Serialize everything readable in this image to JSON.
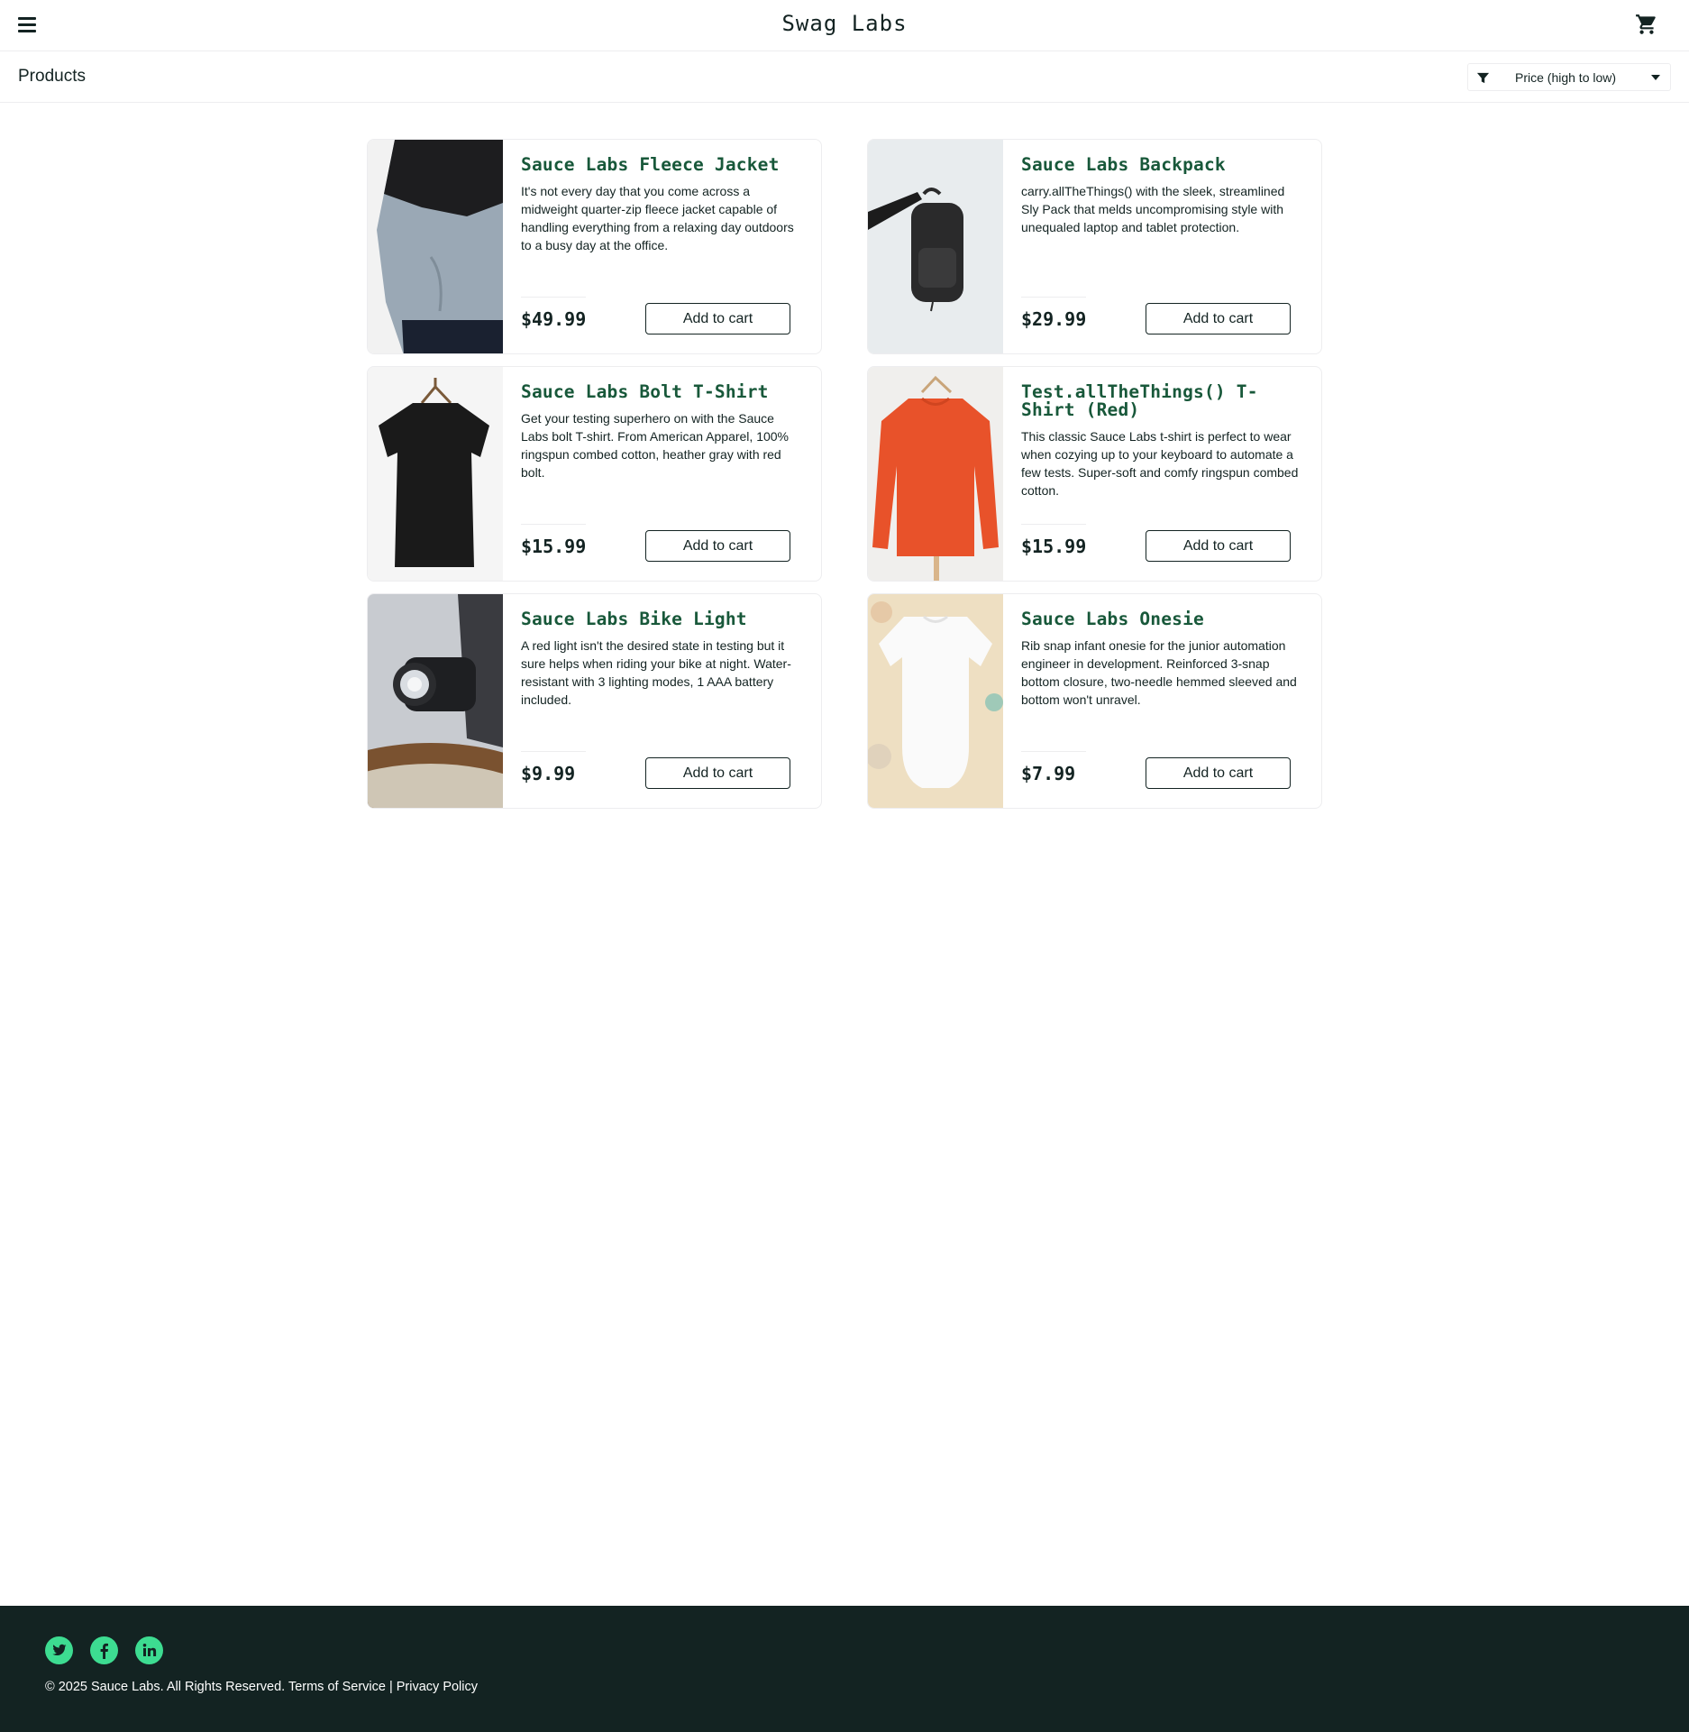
{
  "header": {
    "app_title": "Swag Labs",
    "menu_icon": "hamburger-menu-icon",
    "cart_icon": "shopping-cart-icon"
  },
  "subheader": {
    "title": "Products",
    "sort": {
      "selected": "Price (high to low)",
      "icon": "filter-icon"
    }
  },
  "products": [
    {
      "name": "Sauce Labs Fleece Jacket",
      "description": "It's not every day that you come across a midweight quarter-zip fleece jacket capable of handling everything from a relaxing day outdoors to a busy day at the office.",
      "price": "$49.99",
      "button": "Add to cart"
    },
    {
      "name": "Sauce Labs Backpack",
      "description": "carry.allTheThings() with the sleek, streamlined Sly Pack that melds uncompromising style with unequaled laptop and tablet protection.",
      "price": "$29.99",
      "button": "Add to cart"
    },
    {
      "name": "Sauce Labs Bolt T-Shirt",
      "description": "Get your testing superhero on with the Sauce Labs bolt T-shirt. From American Apparel, 100% ringspun combed cotton, heather gray with red bolt.",
      "price": "$15.99",
      "button": "Add to cart"
    },
    {
      "name": "Test.allTheThings() T-Shirt (Red)",
      "description": "This classic Sauce Labs t-shirt is perfect to wear when cozying up to your keyboard to automate a few tests. Super-soft and comfy ringspun combed cotton.",
      "price": "$15.99",
      "button": "Add to cart"
    },
    {
      "name": "Sauce Labs Bike Light",
      "description": "A red light isn't the desired state in testing but it sure helps when riding your bike at night. Water-resistant with 3 lighting modes, 1 AAA battery included.",
      "price": "$9.99",
      "button": "Add to cart"
    },
    {
      "name": "Sauce Labs Onesie",
      "description": "Rib snap infant onesie for the junior automation engineer in development. Reinforced 3-snap bottom closure, two-needle hemmed sleeved and bottom won't unravel.",
      "price": "$7.99",
      "button": "Add to cart"
    }
  ],
  "footer": {
    "social": [
      "twitter-icon",
      "facebook-icon",
      "linkedin-icon"
    ],
    "copy": "© 2025 Sauce Labs. All Rights Reserved. Terms of Service | Privacy Policy"
  },
  "colors": {
    "brand_dark": "#132322",
    "product_name": "#18583a",
    "social_green": "#3ddc91",
    "border": "#ededef"
  }
}
